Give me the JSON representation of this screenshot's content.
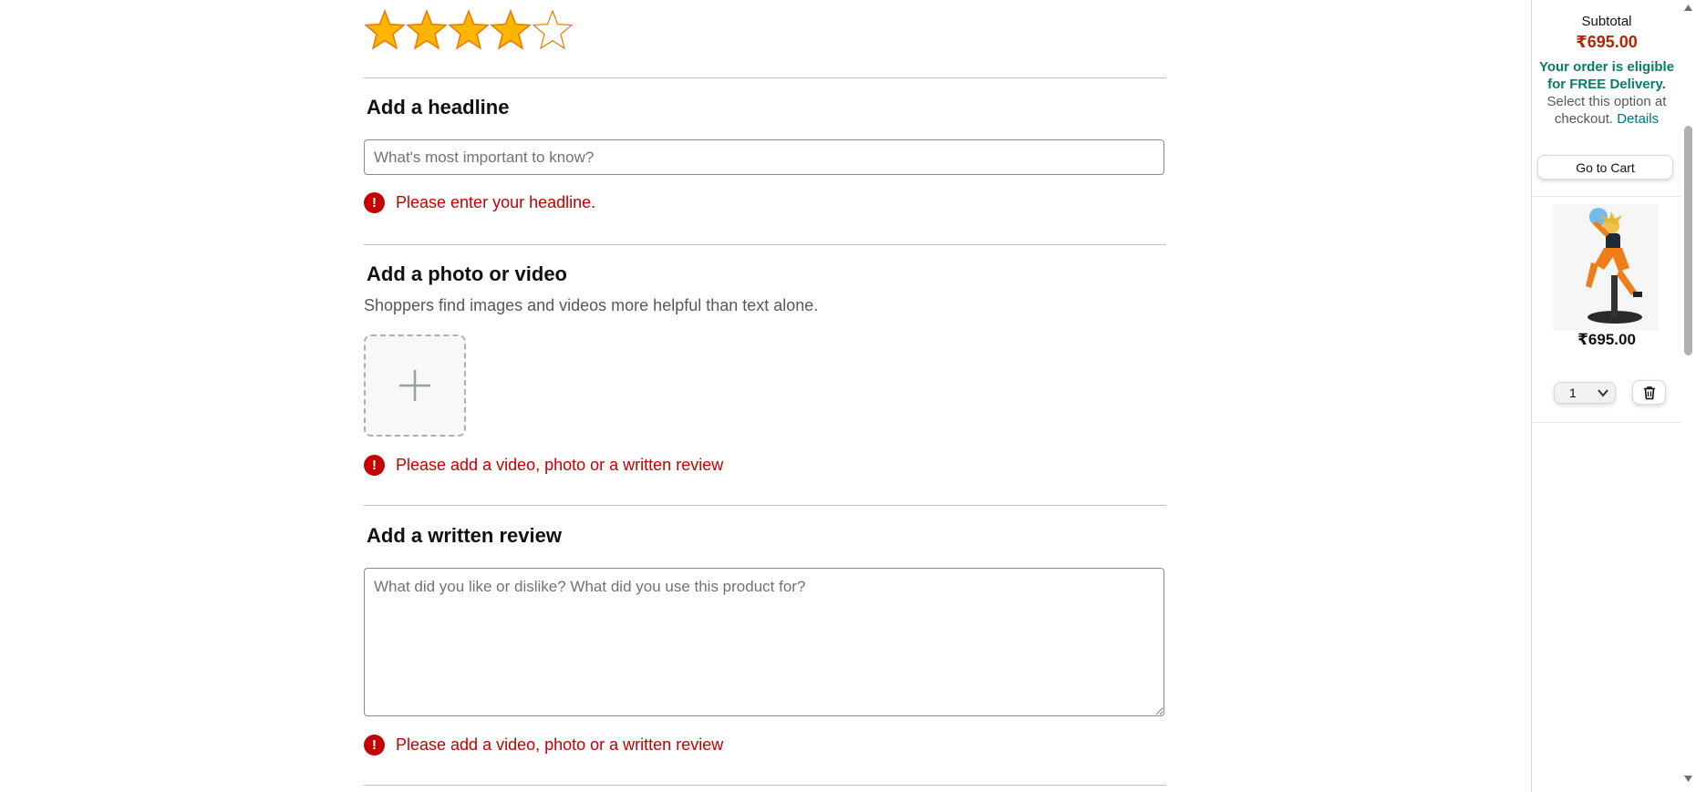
{
  "review": {
    "rating": 4,
    "max_rating": 5,
    "headline": {
      "title": "Add a headline",
      "placeholder": "What's most important to know?",
      "value": "",
      "error": "Please enter your headline."
    },
    "media": {
      "title": "Add a photo or video",
      "subtitle": "Shoppers find images and videos more helpful than text alone.",
      "error": "Please add a video, photo or a written review"
    },
    "written": {
      "title": "Add a written review",
      "placeholder": "What did you like or dislike? What did you use this product for?",
      "value": "",
      "error": "Please add a video, photo or a written review"
    },
    "error_icon_glyph": "!"
  },
  "sidebar": {
    "subtotal_label": "Subtotal",
    "subtotal_value": "₹695.00",
    "delivery_highlight": "Your order is eligible for FREE Delivery.",
    "delivery_rest": " Select this option at checkout. ",
    "details_link": "Details",
    "go_to_cart": "Go to Cart",
    "item": {
      "price": "₹695.00",
      "quantity": "1"
    }
  },
  "colors": {
    "star_fill": "#ffa41c",
    "error": "#c40000",
    "price": "#b12704",
    "delivery_green": "#067d62",
    "link": "#007185"
  }
}
